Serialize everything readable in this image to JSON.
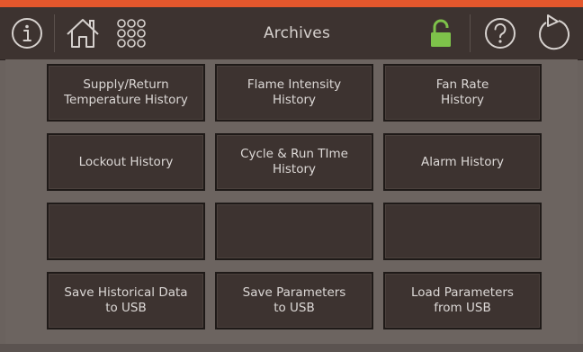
{
  "header": {
    "title": "Archives",
    "icons": [
      "info-icon",
      "home-icon",
      "menu-grid-icon",
      "unlock-icon",
      "help-icon",
      "back-icon"
    ]
  },
  "colors": {
    "accent": "#e4572c",
    "header_bg": "#3d3330",
    "tile_bg": "#3d3330",
    "panel_bg": "#6a625e",
    "unlock_green": "#7ec24a",
    "icon_stroke": "#d6d1ce"
  },
  "tiles": [
    {
      "label": "Supply/Return\nTemperature History"
    },
    {
      "label": "Flame Intensity\nHistory"
    },
    {
      "label": "Fan Rate\nHistory"
    },
    {
      "label": "Lockout History"
    },
    {
      "label": "Cycle & Run TIme\nHistory"
    },
    {
      "label": "Alarm History"
    },
    {
      "label": ""
    },
    {
      "label": ""
    },
    {
      "label": ""
    },
    {
      "label": "Save Historical Data\nto USB"
    },
    {
      "label": "Save Parameters\nto USB"
    },
    {
      "label": "Load Parameters\nfrom USB"
    }
  ]
}
